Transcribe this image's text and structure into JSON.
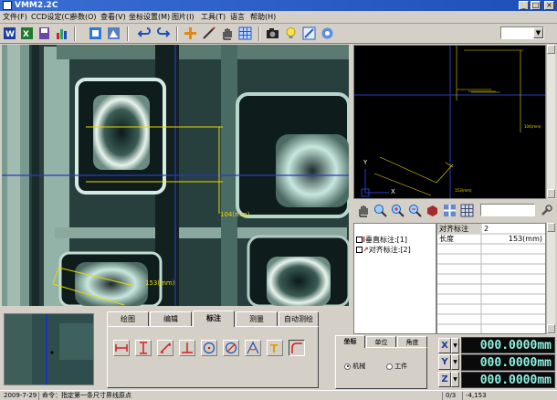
{
  "window": {
    "title": "VMM2.2C"
  },
  "menu": [
    "文件(F)",
    "CCD设定(C)",
    "参数(O)",
    "查看(V)",
    "坐标设置(M)",
    "图片(I)",
    "工具(T)",
    "语言",
    "帮助(H)"
  ],
  "toolbar": {
    "combo_value": ""
  },
  "measurements": {
    "vertical": "104(mm)",
    "aligned": "153(mm)"
  },
  "preview": {
    "y_axis": "Y",
    "x_axis": "X",
    "label_v": "104(mm)",
    "label_a": "153(mm)"
  },
  "tree": {
    "item1": "垂直标注:[1]",
    "item2": "对齐标注:[2]"
  },
  "props": {
    "rows": [
      {
        "k": "对齐标注",
        "v": "2"
      },
      {
        "k": "长度",
        "v": "153(mm)"
      }
    ]
  },
  "tabs": [
    "绘图",
    "编辑",
    "标注",
    "测量",
    "自动测绘"
  ],
  "coord": {
    "tabs": [
      "坐标",
      "单位",
      "角度"
    ],
    "opt1": "机械",
    "opt2": "工件"
  },
  "readout": {
    "x_label": "X",
    "y_label": "Y",
    "z_label": "Z",
    "x": "000.0000mm",
    "y": "000.0000mm",
    "z": "000.0000mm"
  },
  "status": {
    "date": "2009-7-29",
    "command": "命令：指定第一条尺寸界线原点",
    "frames": "0/3",
    "pos": "-4,153"
  }
}
